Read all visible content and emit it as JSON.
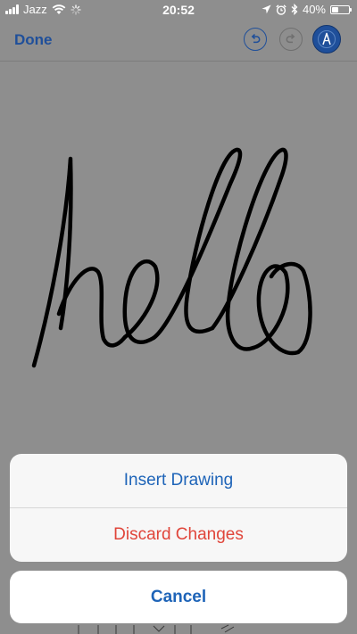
{
  "status_bar": {
    "carrier": "Jazz",
    "time": "20:52",
    "battery": "40%",
    "battery_level": 0.4,
    "icons": [
      "signal-icon",
      "wifi-icon",
      "activity-spinner-icon",
      "location-icon",
      "alarm-icon",
      "bluetooth-icon",
      "battery-icon"
    ]
  },
  "toolbar": {
    "done_label": "Done",
    "icons": [
      "undo-icon",
      "redo-icon",
      "markup-pen-icon"
    ],
    "accent_color": "#1f4f9a"
  },
  "canvas": {
    "drawing": "handwritten hello",
    "ink_color": "#000000"
  },
  "action_sheet": {
    "insert_label": "Insert Drawing",
    "discard_label": "Discard Changes",
    "cancel_label": "Cancel",
    "insert_color": "#1e64b8",
    "discard_color": "#e0453a"
  }
}
